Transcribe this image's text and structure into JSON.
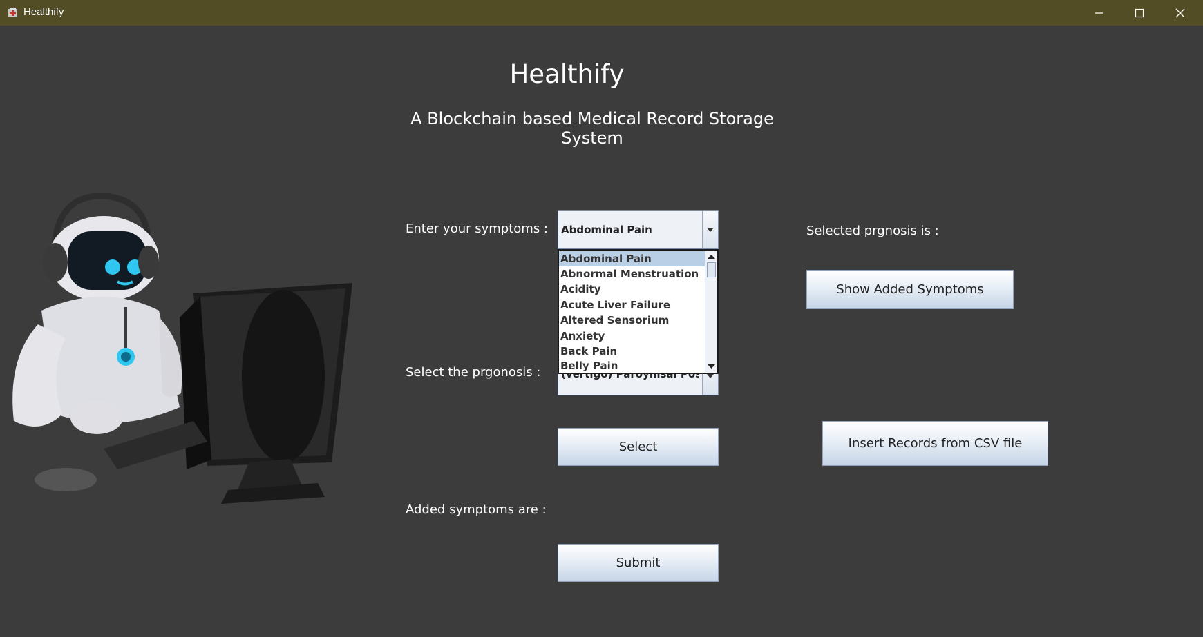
{
  "window": {
    "title": "Healthify"
  },
  "header": {
    "title": "Healthify",
    "subtitle": "A Blockchain based Medical Record Storage System"
  },
  "form": {
    "symptoms_label": "Enter your symptoms :",
    "symptoms_value": "Abdominal Pain",
    "symptoms_options": [
      "Abdominal Pain",
      "Abnormal Menstruation",
      "Acidity",
      "Acute Liver Failure",
      "Altered Sensorium",
      "Anxiety",
      "Back Pain",
      "Belly Pain"
    ],
    "prognosis_label": "Select the prgonosis :",
    "prognosis_value": "(vertigo) Paroymsal Positional Vertigo",
    "added_symptoms_label": "Added symptoms are :",
    "selected_prognosis_label": "Selected prgnosis is :"
  },
  "buttons": {
    "select": "Select",
    "submit": "Submit",
    "show_added": "Show Added Symptoms",
    "insert_csv": "Insert Records from CSV file"
  }
}
